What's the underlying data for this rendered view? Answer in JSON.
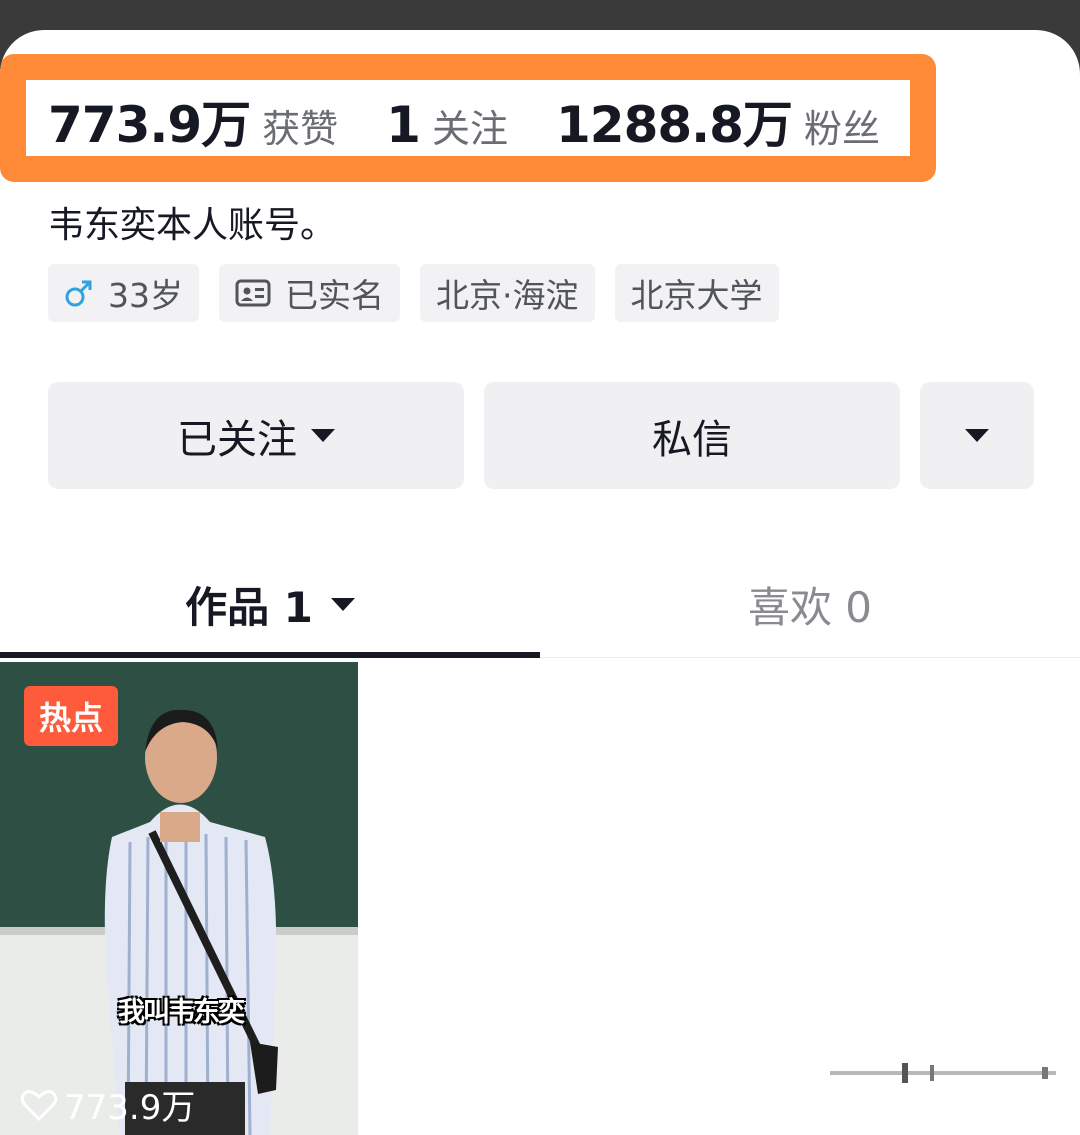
{
  "stats": {
    "likes_value": "773.9万",
    "likes_label": "获赞",
    "following_value": "1",
    "following_label": "关注",
    "followers_value": "1288.8万",
    "followers_label": "粉丝"
  },
  "bio": "韦东奕本人账号。",
  "tags": {
    "gender_icon": "male-icon",
    "age": "33岁",
    "verified_icon": "id-card-icon",
    "verified": "已实名",
    "location": "北京·海淀",
    "school": "北京大学"
  },
  "actions": {
    "follow_label": "已关注",
    "message_label": "私信"
  },
  "tabs": {
    "works_label": "作品 1",
    "likes_label": "喜欢 0"
  },
  "video": {
    "badge": "热点",
    "caption": "我叫韦东奕",
    "likes": "773.9万"
  },
  "colors": {
    "highlight": "#ff8a38",
    "hot_badge": "#fe5b3c"
  }
}
